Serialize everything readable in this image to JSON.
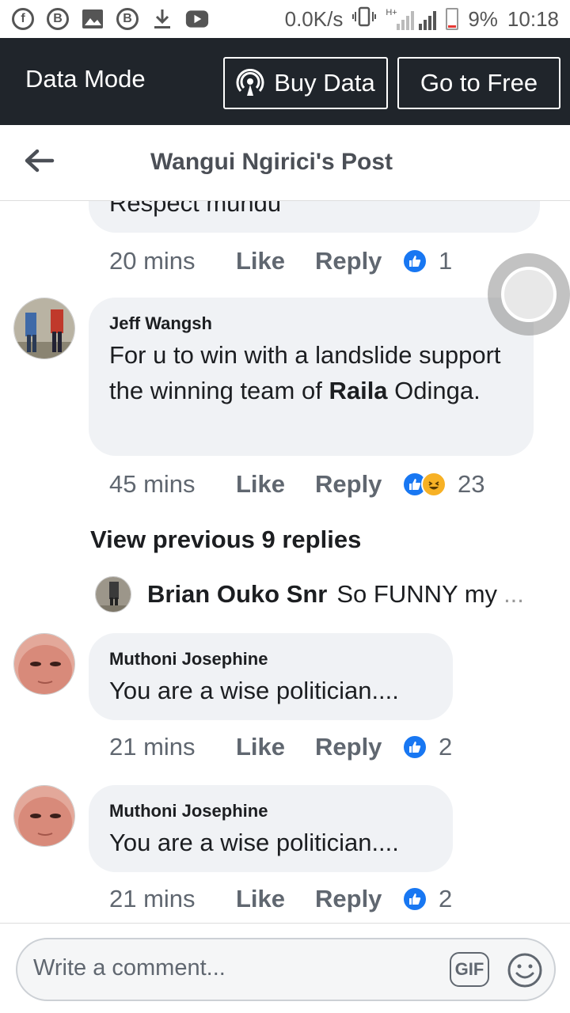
{
  "status_bar": {
    "icons": [
      "facebook-icon",
      "bitcoin-icon",
      "image-icon",
      "bitcoin-icon",
      "download-icon",
      "youtube-icon"
    ],
    "net_speed": "0.0K/s",
    "network": "H+",
    "battery": "9%",
    "time": "10:18"
  },
  "top_bar": {
    "mode_label": "Data Mode",
    "buy_label": "Buy Data",
    "free_label": "Go to Free"
  },
  "header": {
    "title": "Wangui Ngirici's Post"
  },
  "comments": [
    {
      "text": "Respect mundu",
      "time": "20 mins",
      "like": "Like",
      "reply": "Reply",
      "count": "1"
    },
    {
      "author": "Jeff Wangsh",
      "text_before": "For u to win with a landslide support the winning team of ",
      "text_bold": "Raila",
      "text_after": " Odinga.",
      "time": "45 mins",
      "like": "Like",
      "reply": "Reply",
      "count": "23"
    },
    {
      "author": "Muthoni Josephine",
      "text": "You are a wise politician....",
      "time": "21 mins",
      "like": "Like",
      "reply": "Reply",
      "count": "2"
    },
    {
      "author": "Muthoni Josephine",
      "text": "You are a wise politician....",
      "time": "21 mins",
      "like": "Like",
      "reply": "Reply",
      "count": "2"
    }
  ],
  "view_previous": "View previous 9 replies",
  "reply_preview": {
    "name": "Brian Ouko Snr",
    "text": "So FUNNY my",
    "ellipsis": "..."
  },
  "composer": {
    "placeholder": "Write a comment...",
    "gif_label": "GIF"
  },
  "colors": {
    "top_bar_bg": "#20252b",
    "bubble_bg": "#f0f2f5",
    "like_blue": "#1877f2",
    "meta_gray": "#606770"
  }
}
